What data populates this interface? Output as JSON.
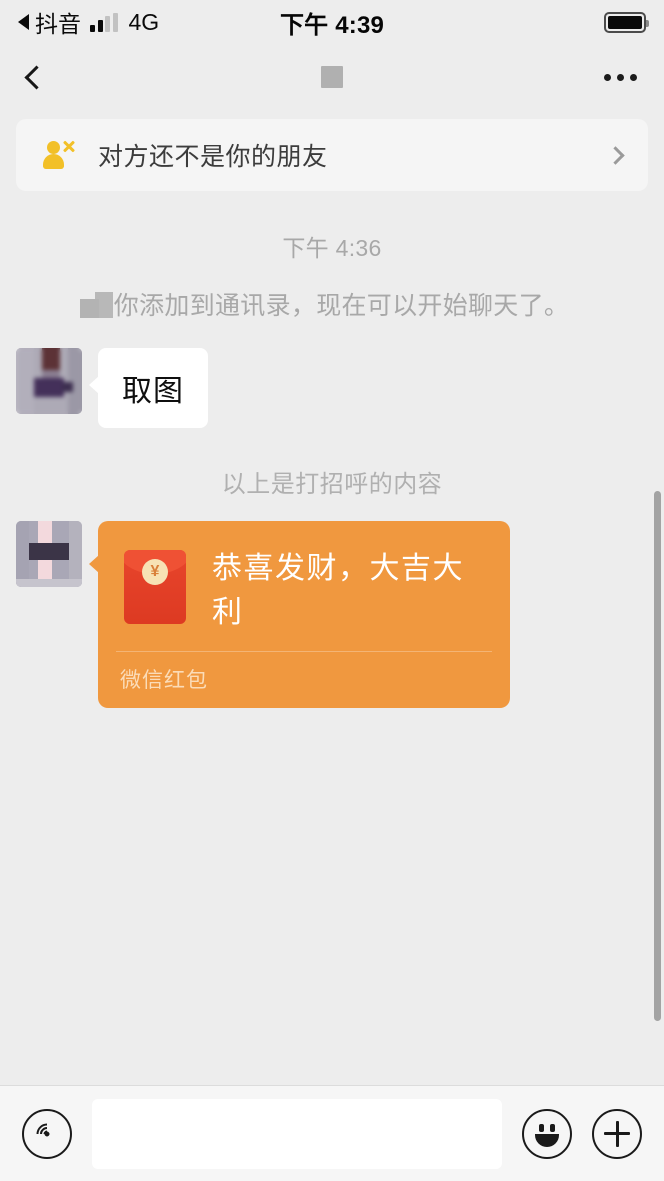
{
  "status_bar": {
    "carrier_back_label": "抖音",
    "network_type": "4G",
    "time": "下午 4:39",
    "battery_level": "full",
    "signal_bars_active": 2,
    "signal_bars_total": 4
  },
  "nav_bar": {
    "back_icon": "chevron-left-icon",
    "title": "",
    "title_redacted": true,
    "more_icon": "more-horizontal-icon"
  },
  "notice": {
    "icon": "person-remove-icon",
    "text": "对方还不是你的朋友",
    "chevron_icon": "chevron-right-icon",
    "icon_color": "#f2c028"
  },
  "chat": {
    "timestamp": "下午 4:36",
    "system_message": "你添加到通讯录，现在可以开始聊天了。",
    "greeting_note": "以上是打招呼的内容",
    "messages": [
      {
        "type": "text",
        "avatar": "blurred-avatar-a",
        "text": "取图"
      },
      {
        "type": "red-packet",
        "avatar": "blurred-avatar-b",
        "title": "恭喜发财，大吉大利",
        "footer": "微信红包",
        "currency_symbol": "¥",
        "bubble_color": "#f0983f",
        "envelope_color": "#e8452c"
      }
    ]
  },
  "input_bar": {
    "voice_icon": "voice-wave-icon",
    "input_value": "",
    "input_placeholder": "",
    "emoji_icon": "smiley-icon",
    "plus_icon": "plus-icon"
  }
}
